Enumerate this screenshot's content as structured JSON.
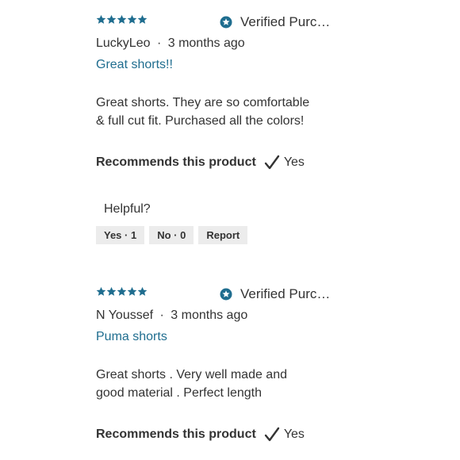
{
  "colors": {
    "accent": "#1f6d8f",
    "star": "#1f6d8f",
    "text": "#333333",
    "button_bg": "#ececec"
  },
  "reviews": [
    {
      "rating": 5,
      "verified_label": "Verified Purcha...",
      "author": "LuckyLeo",
      "separator": "·",
      "time": "3 months ago",
      "title": "Great shorts!!",
      "body_lines": [
        "Great shorts. They are so comfortable",
        "& full cut fit. Purchased all the colors!"
      ],
      "recommend_label": "Recommends this product",
      "recommend_value": "Yes",
      "helpful_label": "Helpful?",
      "yes_button": "Yes · 1",
      "no_button": "No · 0",
      "report_button": "Report"
    },
    {
      "rating": 5,
      "verified_label": "Verified Purcha...",
      "author": "N Youssef",
      "separator": "·",
      "time": "3 months ago",
      "title": "Puma shorts",
      "body_lines": [
        "Great shorts . Very well made and",
        "good material . Perfect length"
      ],
      "recommend_label": "Recommends this product",
      "recommend_value": "Yes"
    }
  ]
}
